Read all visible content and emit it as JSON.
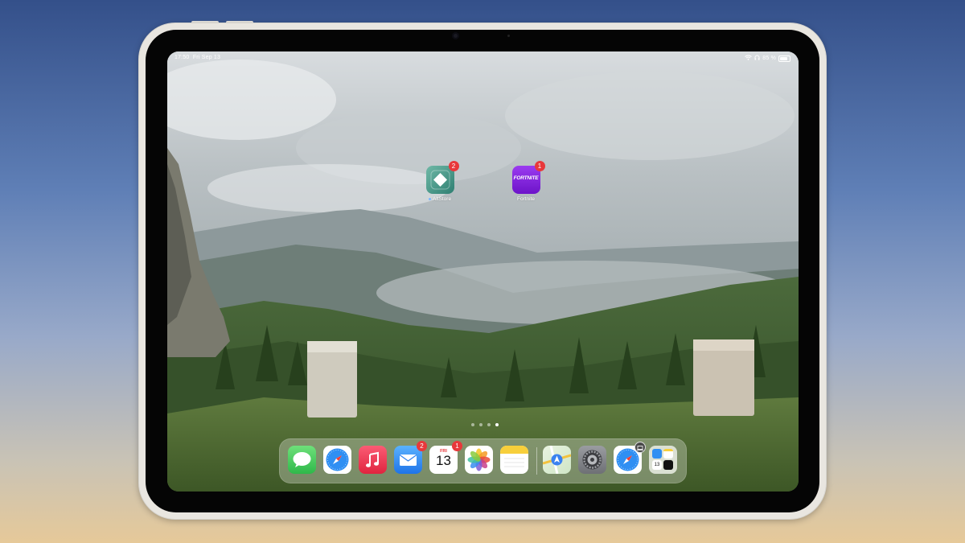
{
  "status_bar": {
    "time": "17:50",
    "date": "Fri Sep 13",
    "battery": "85 %",
    "battery_level": 0.85
  },
  "home_apps": [
    {
      "label": "AltStore",
      "badge": "2"
    },
    {
      "label": "Fortnite",
      "badge": "1",
      "icon_text": "FORTNITE"
    }
  ],
  "page_dots": {
    "count": 4,
    "active_index": 3
  },
  "dock": {
    "apps": [
      {
        "name": "Messages",
        "icon": "messages-icon"
      },
      {
        "name": "Safari",
        "icon": "safari-icon"
      },
      {
        "name": "Music",
        "icon": "music-icon"
      },
      {
        "name": "Mail",
        "icon": "mail-icon",
        "badge": "2"
      },
      {
        "name": "Calendar",
        "icon": "calendar-icon",
        "badge": "1",
        "day_label": "FRI",
        "day_number": "13"
      },
      {
        "name": "Photos",
        "icon": "photos-icon"
      },
      {
        "name": "Notes",
        "icon": "notes-icon"
      },
      {
        "name": "Maps",
        "icon": "maps-icon"
      },
      {
        "name": "Settings",
        "icon": "settings-icon"
      },
      {
        "name": "Safari",
        "icon": "safari-icon"
      },
      {
        "name": "App Library",
        "icon": "app-library-icon",
        "mini_number": "13"
      }
    ]
  },
  "colors": {
    "badge": "#e8383b",
    "altstore": "#3f9d8c",
    "fortnite": "#8a2be2"
  }
}
